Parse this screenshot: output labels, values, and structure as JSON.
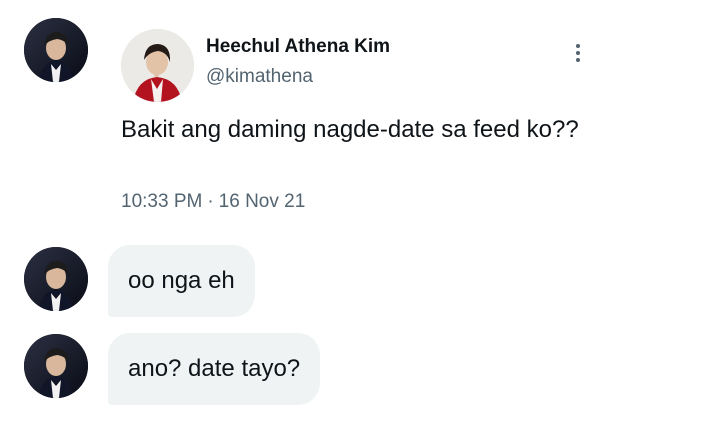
{
  "tweet": {
    "author_name": "Heechul Athena Kim",
    "author_handle": "@kimathena",
    "text": "Bakit ang daming nagde-date sa feed ko??",
    "time": "10:33 PM",
    "separator": "·",
    "date": "16 Nov 21",
    "more_icon": "more-vertical-icon"
  },
  "messages": [
    {
      "text": "oo nga eh"
    },
    {
      "text": "ano? date tayo?"
    }
  ],
  "colors": {
    "text_primary": "#0f1419",
    "text_secondary": "#536471",
    "bubble_bg": "#eff3f4",
    "background": "#ffffff"
  }
}
